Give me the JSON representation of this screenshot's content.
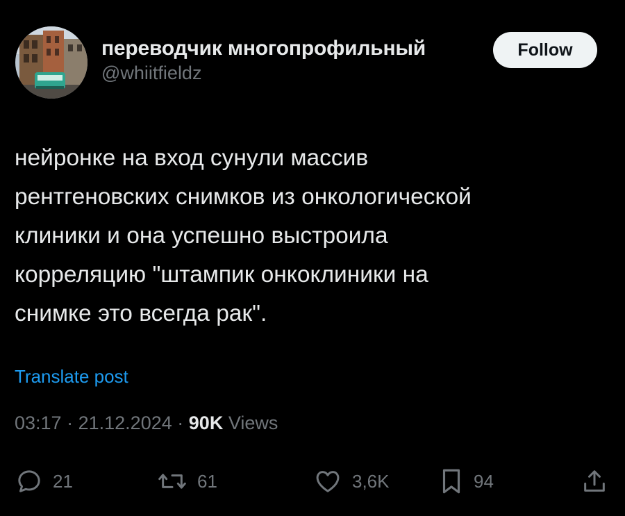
{
  "author": {
    "display_name": "переводчик многопрофильный",
    "handle": "@whiitfieldz",
    "avatar_icon": "avatar-photo-street-tram"
  },
  "follow_button": {
    "label": "Follow"
  },
  "post": {
    "lines": [
      "нейронке на вход сунули массив",
      "рентгеновских снимков из онкологической",
      "клиники и она успешно выстроила",
      "корреляцию \"штампик онкоклиники на",
      "снимке это всегда рак\"."
    ]
  },
  "translate": {
    "label": "Translate post"
  },
  "meta": {
    "time": "03:17",
    "separator": "·",
    "date": "21.12.2024",
    "views_count": "90K",
    "views_label": "Views"
  },
  "actions": {
    "replies": "21",
    "reposts": "61",
    "likes": "3,6K",
    "bookmarks": "94"
  },
  "colors": {
    "background": "#000000",
    "primary_text": "#e7e9ea",
    "secondary_text": "#71767b",
    "link": "#1d9bf0",
    "follow_bg": "#eff3f4",
    "follow_text": "#0f1419"
  }
}
